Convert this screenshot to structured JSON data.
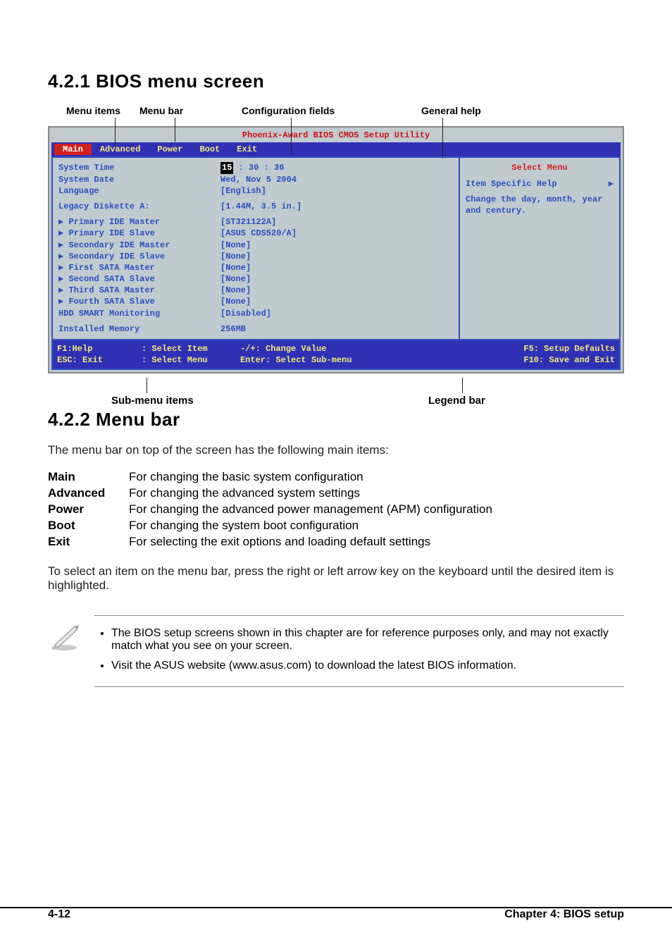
{
  "headings": {
    "h421": "4.2.1  BIOS menu screen",
    "h422": "4.2.2  Menu bar"
  },
  "labels": {
    "menuitems": "Menu items",
    "menubar": "Menu bar",
    "config": "Configuration fields",
    "general": "General help",
    "submenu": "Sub-menu items",
    "legendbar": "Legend bar"
  },
  "bios": {
    "title": "Phoenix-Award BIOS CMOS Setup Utility",
    "tabs": {
      "main": "Main",
      "advanced": "Advanced",
      "power": "Power",
      "boot": "Boot",
      "exit": "Exit"
    },
    "left": {
      "systime_k": "System Time",
      "systime_v_hr": "15",
      "systime_v_rest": " : 30 : 36",
      "sysdate_k": "System Date",
      "sysdate_v": "Wed, Nov 5 2004",
      "lang_k": "Language",
      "lang_v": "[English]",
      "legacy_k": "Legacy Diskette A:",
      "legacy_v": "[1.44M, 3.5 in.]",
      "pim_k": "Primary IDE Master",
      "pim_v": "[ST321122A]",
      "pis_k": "Primary IDE Slave",
      "pis_v": "[ASUS CDS520/A]",
      "sim_k": "Secondary IDE Master",
      "sim_v": "[None]",
      "sis_k": "Secondary IDE Slave",
      "sis_v": "[None]",
      "fsa_k": "First SATA Master",
      "fsa_v": "[None]",
      "ssa_k": "Second SATA Slave",
      "ssa_v": "[None]",
      "tsa_k": "Third SATA Master",
      "tsa_v": "[None]",
      "fosa_k": "Fourth SATA Slave",
      "fosa_v": "[None]",
      "hdd_k": "HDD SMART Monitoring",
      "hdd_v": "[Disabled]",
      "mem_k": "Installed Memory",
      "mem_v": "256MB"
    },
    "right": {
      "select": "Select Menu",
      "itemhelp": "Item Specific Help",
      "desc": "Change the day, month, year and century."
    },
    "legend": {
      "f1": "F1:Help",
      "esc": "ESC: Exit",
      "si": ": Select Item",
      "sm": ": Select Menu",
      "cv": "-/+: Change Value",
      "ss": "Enter: Select Sub-menu",
      "sd": "F5: Setup Defaults",
      "se": "F10: Save and Exit"
    }
  },
  "menubar_intro": "The menu bar on top of the screen has the following main items:",
  "defs": {
    "main_t": "Main",
    "main_d": "For changing the basic system configuration",
    "adv_t": "Advanced",
    "adv_d": "For changing the advanced system settings",
    "pwr_t": "Power",
    "pwr_d": "For changing the advanced power management (APM) configuration",
    "boot_t": "Boot",
    "boot_d": "For changing the system boot configuration",
    "exit_t": "Exit",
    "exit_d": "For selecting the exit options and loading default settings"
  },
  "select_text": "To select an item on the menu bar, press the right or left arrow key on the keyboard until the desired item is highlighted.",
  "notes": {
    "n1": "The BIOS setup screens shown in this chapter are for reference purposes only, and may not exactly match what you see on your screen.",
    "n2": "Visit the ASUS website (www.asus.com) to download the latest BIOS information."
  },
  "footer": {
    "page": "4-12",
    "chapter": "Chapter 4: BIOS setup"
  }
}
